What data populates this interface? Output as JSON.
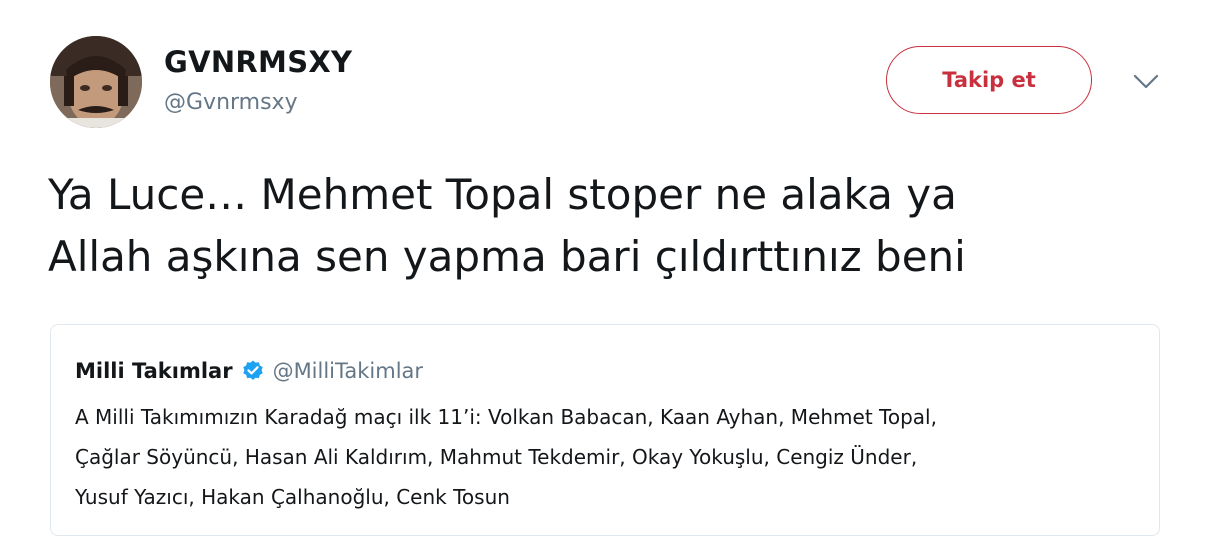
{
  "tweet": {
    "author": {
      "display_name": "GVNRMSXY",
      "screen_name": "@Gvnrmsxy",
      "avatar_icon": "avatar-photo"
    },
    "follow_button_label": "Takip et",
    "menu_icon": "chevron-down-icon",
    "text_line_1": "Ya Luce… Mehmet Topal stoper ne alaka ya",
    "text_line_2": "Allah aşkına sen yapma bari çıldırttınız beni"
  },
  "quoted_tweet": {
    "display_name": "Milli Takımlar",
    "verified": true,
    "screen_name": "@MilliTakimlar",
    "text_line_1": "A Milli Takımımızın Karadağ maçı ilk 11’i: Volkan Babacan, Kaan Ayhan, Mehmet Topal,",
    "text_line_2": "Çağlar Söyüncü, Hasan Ali Kaldırım, Mahmut Tekdemir, Okay Yokuşlu, Cengiz Ünder,",
    "text_line_3": "Yusuf Yazıcı, Hakan Çalhanoğlu, Cenk Tosun"
  },
  "colors": {
    "follow_accent": "#c8303d",
    "verified_blue": "#1da1f2",
    "secondary_text": "#657786",
    "card_border": "#e1e8ed"
  }
}
